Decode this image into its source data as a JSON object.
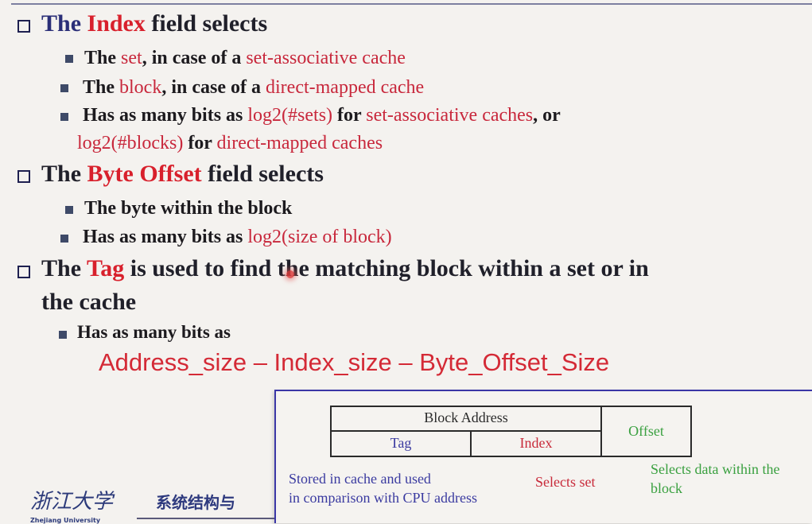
{
  "section1": {
    "pre": "The ",
    "keyword": "Index",
    "post": " field selects",
    "items": [
      {
        "p1": "The ",
        "k1": "set",
        "p2": ", in case of a ",
        "k2": "set-associative cache"
      },
      {
        "p1": "The ",
        "k1": "block",
        "p2": ", in case of a ",
        "k2": "direct-mapped cache"
      }
    ],
    "item3": {
      "p1": "Has as many bits as ",
      "k1": "log2(#sets)",
      "p2": " for ",
      "k2": "set-associative caches",
      "p3": ", or",
      "k3": "log2(#blocks)",
      "p4": " for ",
      "k4": "direct-mapped caches"
    }
  },
  "section2": {
    "pre": "The ",
    "keyword": "Byte Offset",
    "post": " field selects",
    "item1": "The byte within the block",
    "item2": {
      "p1": "Has as many bits as ",
      "k1": "log2(size of block)"
    }
  },
  "section3": {
    "pre": "The ",
    "keyword": "Tag",
    "post": " is used to find the matching block within a set or in",
    "line2": "the cache",
    "item1": "Has as many bits as",
    "formula": "Address_size – Index_size – Byte_Offset_Size"
  },
  "diagram": {
    "block_address": "Block Address",
    "tag": "Tag",
    "index": "Index",
    "offset": "Offset",
    "note_tag_1": "Stored in cache and used",
    "note_tag_2": "in comparison with CPU address",
    "note_index": "Selects set",
    "note_offset_1": "Selects data within the",
    "note_offset_2": "block",
    "colors": {
      "tag_note": "#3a3aa0",
      "index": "#c82a3a",
      "offset": "#3aa040"
    }
  },
  "footer": {
    "logo": "浙江大学",
    "logo_sub": "Zhejiang University",
    "course": "系统结构与"
  }
}
